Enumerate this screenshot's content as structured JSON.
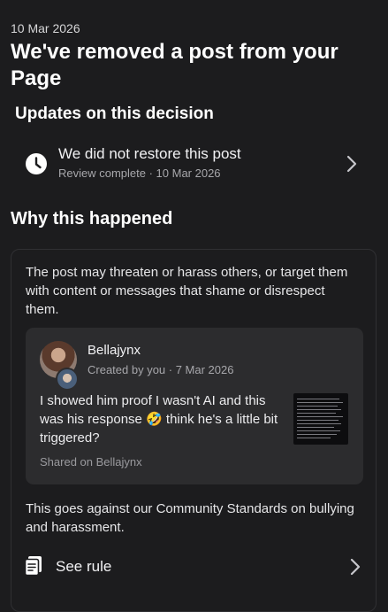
{
  "date": "10 Mar 2026",
  "headline": "We've removed a post from your Page",
  "updates": {
    "heading": "Updates on this decision",
    "item": {
      "icon": "clock-icon",
      "title": "We did not restore this post",
      "subtitle": "Review complete · 10 Mar 2026"
    }
  },
  "why": {
    "heading": "Why this happened",
    "reason": "The post may threaten or harass others, or target them with content or messages that shame or disrespect them.",
    "post": {
      "author": "Bellajynx",
      "meta": "Created by you · 7 Mar 2026",
      "text": "I showed him proof I wasn't AI and this was his response 🤣 think he's a little bit triggered?",
      "shared_on": "Shared on Bellajynx"
    },
    "standards": "This goes against our Community Standards on bullying and harassment.",
    "see_rule": {
      "icon": "document-icon",
      "label": "See rule"
    }
  },
  "colors": {
    "background": "#1c1c1e",
    "card_background": "#2c2c2e",
    "secondary_text": "#a7a7ab"
  }
}
